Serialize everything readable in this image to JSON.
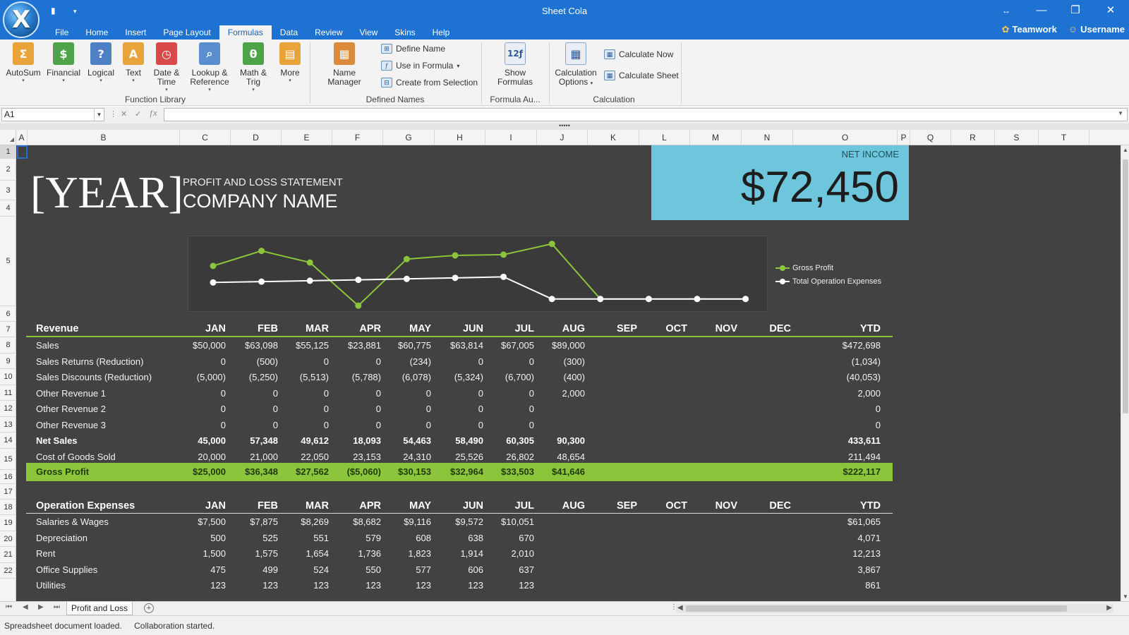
{
  "window": {
    "title": "Sheet Cola",
    "app_logo_letter": "X",
    "qat_save_icon": "save-icon",
    "qat_dropdown_icon": "chevron-down-icon",
    "controls": {
      "resize": "↔",
      "minimize": "—",
      "restore": "❐",
      "close": "✕"
    }
  },
  "tabs": [
    "File",
    "Home",
    "Insert",
    "Page Layout",
    "Formulas",
    "Data",
    "Review",
    "View",
    "Skins",
    "Help"
  ],
  "active_tab": "Formulas",
  "user": {
    "teamwork": "Teamwork",
    "username": "Username"
  },
  "ribbon": {
    "function_library": {
      "label": "Function Library",
      "buttons": [
        {
          "line1": "AutoSum",
          "line2": "",
          "glyph": "Σ",
          "color": "#e8a33a"
        },
        {
          "line1": "Financial",
          "line2": "",
          "glyph": "$",
          "color": "#4ea34a"
        },
        {
          "line1": "Logical",
          "line2": "",
          "glyph": "?",
          "color": "#4f7fc4"
        },
        {
          "line1": "Text",
          "line2": "",
          "glyph": "A",
          "color": "#e8a33a"
        },
        {
          "line1": "Date &",
          "line2": "Time",
          "glyph": "◷",
          "color": "#d84a4a"
        },
        {
          "line1": "Lookup &",
          "line2": "Reference",
          "glyph": "⌕",
          "color": "#5a8fce"
        },
        {
          "line1": "Math &",
          "line2": "Trig",
          "glyph": "θ",
          "color": "#4ea34a"
        },
        {
          "line1": "More",
          "line2": "",
          "glyph": "▤",
          "color": "#e8a33a"
        }
      ]
    },
    "defined_names": {
      "label": "Defined Names",
      "name_manager": "Name Manager",
      "define_name": "Define Name",
      "use_in_formula": "Use in Formula",
      "create_from_selection": "Create from Selection"
    },
    "formula_auditing": {
      "label": "Formula Au...",
      "show_formulas": "Show Formulas"
    },
    "calculation": {
      "label": "Calculation",
      "options_line1": "Calculation",
      "options_line2": "Options",
      "calculate_now": "Calculate Now",
      "calculate_sheet": "Calculate Sheet"
    }
  },
  "formula_bar": {
    "name_box": "A1",
    "formula": ""
  },
  "columns": [
    "A",
    "B",
    "C",
    "D",
    "E",
    "F",
    "G",
    "H",
    "I",
    "J",
    "K",
    "L",
    "M",
    "N",
    "O",
    "P",
    "Q",
    "R",
    "S",
    "T"
  ],
  "rows": [
    "1",
    "2",
    "3",
    "4",
    "5",
    "6",
    "7",
    "8",
    "9",
    "10",
    "11",
    "12",
    "13",
    "14",
    "15",
    "16",
    "17",
    "18",
    "19",
    "20",
    "21",
    "22"
  ],
  "report": {
    "year": "[YEAR]",
    "subtitle": "PROFIT AND LOSS STATEMENT",
    "company": "COMPANY NAME",
    "net_income_label": "NET INCOME",
    "net_income_value": "$72,450"
  },
  "chart_data": {
    "type": "line",
    "categories": [
      "JAN",
      "FEB",
      "MAR",
      "APR",
      "MAY",
      "JUN",
      "JUL",
      "AUG",
      "SEP",
      "OCT",
      "NOV",
      "DEC"
    ],
    "series": [
      {
        "name": "Gross Profit",
        "color": "#8cc43c",
        "values": [
          25000,
          36348,
          27562,
          -5060,
          30153,
          32964,
          33503,
          41646,
          0,
          0,
          0,
          0
        ]
      },
      {
        "name": "Total Operation Expenses",
        "color": "#ffffff",
        "values": [
          12500,
          13124,
          13780,
          14470,
          15193,
          15952,
          16753,
          0,
          0,
          0,
          0,
          0
        ]
      }
    ],
    "ylim": [
      -6000,
      42000
    ],
    "grid": false,
    "legend": "right"
  },
  "months": [
    "JAN",
    "FEB",
    "MAR",
    "APR",
    "MAY",
    "JUN",
    "JUL",
    "AUG",
    "SEP",
    "OCT",
    "NOV",
    "DEC"
  ],
  "ytd_label": "YTD",
  "revenue": {
    "title": "Revenue",
    "rows": [
      {
        "label": "Sales",
        "values": [
          "$50,000",
          "$63,098",
          "$55,125",
          "$23,881",
          "$60,775",
          "$63,814",
          "$67,005",
          "$89,000",
          "",
          "",
          "",
          ""
        ],
        "ytd": "$472,698"
      },
      {
        "label": "Sales Returns (Reduction)",
        "values": [
          "0",
          "(500)",
          "0",
          "0",
          "(234)",
          "0",
          "0",
          "(300)",
          "",
          "",
          "",
          ""
        ],
        "ytd": "(1,034)"
      },
      {
        "label": "Sales Discounts (Reduction)",
        "values": [
          "(5,000)",
          "(5,250)",
          "(5,513)",
          "(5,788)",
          "(6,078)",
          "(5,324)",
          "(6,700)",
          "(400)",
          "",
          "",
          "",
          ""
        ],
        "ytd": "(40,053)"
      },
      {
        "label": "Other Revenue 1",
        "values": [
          "0",
          "0",
          "0",
          "0",
          "0",
          "0",
          "0",
          "2,000",
          "",
          "",
          "",
          ""
        ],
        "ytd": "2,000"
      },
      {
        "label": "Other Revenue 2",
        "values": [
          "0",
          "0",
          "0",
          "0",
          "0",
          "0",
          "0",
          "",
          "",
          "",
          "",
          ""
        ],
        "ytd": "0"
      },
      {
        "label": "Other Revenue 3",
        "values": [
          "0",
          "0",
          "0",
          "0",
          "0",
          "0",
          "0",
          "",
          "",
          "",
          "",
          ""
        ],
        "ytd": "0"
      },
      {
        "label": "Net Sales",
        "bold": true,
        "values": [
          "45,000",
          "57,348",
          "49,612",
          "18,093",
          "54,463",
          "58,490",
          "60,305",
          "90,300",
          "",
          "",
          "",
          ""
        ],
        "ytd": "433,611"
      },
      {
        "label": "Cost of Goods Sold",
        "values": [
          "20,000",
          "21,000",
          "22,050",
          "23,153",
          "24,310",
          "25,526",
          "26,802",
          "48,654",
          "",
          "",
          "",
          ""
        ],
        "ytd": "211,494"
      }
    ],
    "gross_profit": {
      "label": "Gross Profit",
      "values": [
        "$25,000",
        "$36,348",
        "$27,562",
        "($5,060)",
        "$30,153",
        "$32,964",
        "$33,503",
        "$41,646",
        "",
        "",
        "",
        ""
      ],
      "ytd": "$222,117"
    }
  },
  "operation_expenses": {
    "title": "Operation Expenses",
    "rows": [
      {
        "label": "Salaries & Wages",
        "values": [
          "$7,500",
          "$7,875",
          "$8,269",
          "$8,682",
          "$9,116",
          "$9,572",
          "$10,051",
          "",
          "",
          "",
          "",
          ""
        ],
        "ytd": "$61,065"
      },
      {
        "label": "Depreciation",
        "values": [
          "500",
          "525",
          "551",
          "579",
          "608",
          "638",
          "670",
          "",
          "",
          "",
          "",
          ""
        ],
        "ytd": "4,071"
      },
      {
        "label": "Rent",
        "values": [
          "1,500",
          "1,575",
          "1,654",
          "1,736",
          "1,823",
          "1,914",
          "2,010",
          "",
          "",
          "",
          "",
          ""
        ],
        "ytd": "12,213"
      },
      {
        "label": "Office Supplies",
        "values": [
          "475",
          "499",
          "524",
          "550",
          "577",
          "606",
          "637",
          "",
          "",
          "",
          "",
          ""
        ],
        "ytd": "3,867"
      },
      {
        "label": "Utilities",
        "values": [
          "123",
          "123",
          "123",
          "123",
          "123",
          "123",
          "123",
          "",
          "",
          "",
          "",
          ""
        ],
        "ytd": "861"
      }
    ]
  },
  "sheet_tab": "Profit and Loss",
  "status": [
    "Spreadsheet document loaded.",
    "Collaboration started."
  ]
}
